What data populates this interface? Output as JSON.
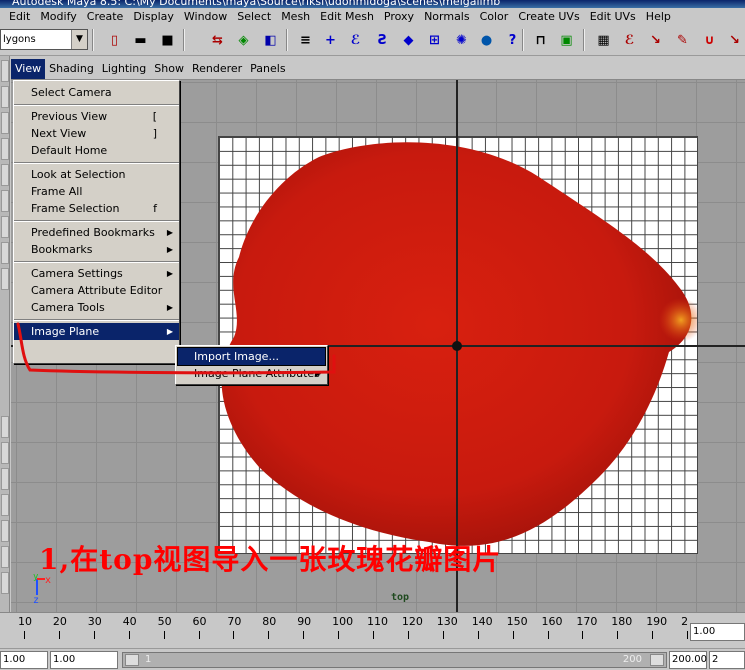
{
  "app": {
    "title": "Autodesk Maya 8.5: C:\\My Documents\\maya\\Source\\riksi\\udonmidoga\\scenes\\meigalimb"
  },
  "menubar": [
    "Edit",
    "Modify",
    "Create",
    "Display",
    "Window",
    "Select",
    "Mesh",
    "Edit Mesh",
    "Proxy",
    "Normals",
    "Color",
    "Create UVs",
    "Edit UVs",
    "Help"
  ],
  "shelf": {
    "mode_value": "lygons"
  },
  "panel_menu": [
    "View",
    "Shading",
    "Lighting",
    "Show",
    "Renderer",
    "Panels"
  ],
  "view_menu": {
    "sections": [
      [
        {
          "label": "Select Camera",
          "shortcut": "",
          "submenu": false
        }
      ],
      [
        {
          "label": "Previous View",
          "shortcut": "[",
          "submenu": false
        },
        {
          "label": "Next View",
          "shortcut": "]",
          "submenu": false
        },
        {
          "label": "Default Home",
          "shortcut": "",
          "submenu": false
        }
      ],
      [
        {
          "label": "Look at Selection",
          "shortcut": "",
          "submenu": false
        },
        {
          "label": "Frame All",
          "shortcut": "",
          "submenu": false
        },
        {
          "label": "Frame Selection",
          "shortcut": "f",
          "submenu": false
        }
      ],
      [
        {
          "label": "Predefined Bookmarks",
          "shortcut": "",
          "submenu": true
        },
        {
          "label": "Bookmarks",
          "shortcut": "",
          "submenu": true
        }
      ],
      [
        {
          "label": "Camera Settings",
          "shortcut": "",
          "submenu": true
        },
        {
          "label": "Camera Attribute Editor",
          "shortcut": "",
          "submenu": false
        },
        {
          "label": "Camera Tools",
          "shortcut": "",
          "submenu": true
        }
      ],
      [
        {
          "label": "Image Plane",
          "shortcut": "",
          "submenu": true,
          "highlighted": true
        }
      ]
    ]
  },
  "image_plane_submenu": [
    {
      "label": "Import Image...",
      "highlighted": true,
      "submenu": false
    },
    {
      "label": "Image Plane Attributes",
      "highlighted": false,
      "submenu": true
    }
  ],
  "viewport": {
    "camera_name": "top",
    "axis_labels": {
      "x": "x",
      "y": "y",
      "z": "z"
    },
    "annotation": "1,在top视图导入一张玫瑰花瓣图片"
  },
  "timeline": {
    "ticks": [
      "10",
      "20",
      "30",
      "40",
      "50",
      "60",
      "70",
      "80",
      "90",
      "100",
      "110",
      "120",
      "130",
      "140",
      "150",
      "160",
      "170",
      "180",
      "190",
      "2"
    ],
    "current_frame": "1.00"
  },
  "range": {
    "start_time": "1.00",
    "playback_start": "1.00",
    "slider_start_label": "1",
    "slider_end_label": "200",
    "playback_end": "200.00",
    "end_time": "2"
  },
  "colors": {
    "highlight": "#0a246a",
    "annotation": "#ff0000",
    "petal": "#c81a0e"
  }
}
